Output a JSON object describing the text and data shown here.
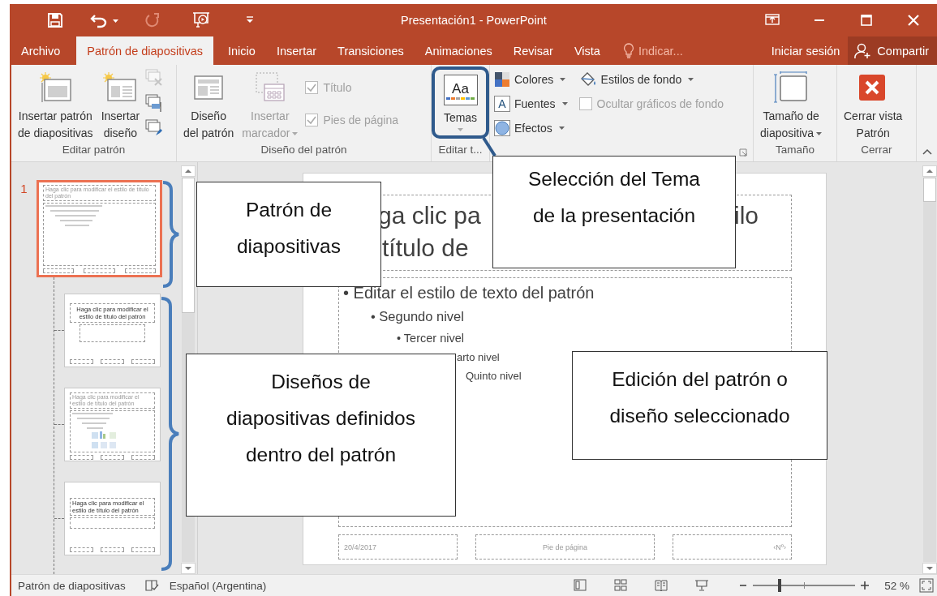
{
  "quick_access": [
    {
      "kind": "save",
      "disabled": false
    },
    {
      "kind": "undo",
      "disabled": false
    },
    {
      "kind": "redo",
      "disabled": true
    },
    {
      "kind": "present",
      "disabled": false
    },
    {
      "kind": "customize",
      "disabled": false
    }
  ],
  "window": {
    "title": "Presentación1 - PowerPoint"
  },
  "tabs": [
    {
      "label": "Archivo",
      "selected": false
    },
    {
      "label": "Patrón de diapositivas",
      "selected": true
    },
    {
      "label": "Inicio",
      "selected": false
    },
    {
      "label": "Insertar",
      "selected": false
    },
    {
      "label": "Transiciones",
      "selected": false
    },
    {
      "label": "Animaciones",
      "selected": false
    },
    {
      "label": "Revisar",
      "selected": false
    },
    {
      "label": "Vista",
      "selected": false
    }
  ],
  "tell_me": {
    "placeholder": "Indicar..."
  },
  "account": {
    "sign_in": "Iniciar sesión",
    "share": "Compartir"
  },
  "ribbon": {
    "groups": [
      {
        "label": "Editar patrón",
        "buttons": [
          {
            "label": "Insertar patrón\nde diapositivas",
            "disabled": false,
            "dropdown": false
          },
          {
            "label": "Insertar\ndiseño",
            "disabled": false,
            "dropdown": false
          }
        ],
        "small_buttons": [
          {
            "disabled": true
          },
          {
            "disabled": false
          },
          {
            "disabled": false
          }
        ]
      },
      {
        "label": "Diseño del patrón",
        "buttons": [
          {
            "label": "Diseño\ndel patrón",
            "disabled": false,
            "dropdown": false
          },
          {
            "label": "Insertar\nmarcador",
            "disabled": true,
            "dropdown": true
          }
        ],
        "checks": [
          {
            "label": "Título",
            "checked": true,
            "disabled": true
          },
          {
            "label": "Pies de página",
            "checked": true,
            "disabled": true
          }
        ]
      },
      {
        "label": "Editar t...",
        "buttons": [
          {
            "label": "Temas",
            "icon_text": "Aa",
            "disabled": false,
            "dropdown": true,
            "highlighted": true
          }
        ]
      },
      {
        "menus": [
          {
            "label": "Colores",
            "dropdown": true
          },
          {
            "label": "Fuentes",
            "icon_text": "A",
            "dropdown": true
          },
          {
            "label": "Efectos",
            "dropdown": true
          },
          {
            "label": "Estilos de fondo",
            "dropdown": true
          }
        ],
        "checks": [
          {
            "label": "Ocultar gráficos de fondo",
            "checked": false,
            "disabled": true
          }
        ]
      },
      {
        "label": "Tamaño",
        "buttons": [
          {
            "label": "Tamaño de\ndiapositiva",
            "disabled": false,
            "dropdown": true
          }
        ]
      },
      {
        "label": "Cerrar",
        "buttons": [
          {
            "label": "Cerrar vista\nPatrón",
            "disabled": false,
            "dropdown": false
          }
        ]
      }
    ]
  },
  "thumbnails": [
    {
      "number": "1",
      "kind": "master",
      "selected": true,
      "title": "Haga clic para modificar el estilo de título del patrón"
    },
    {
      "kind": "title",
      "selected": false,
      "title": "Haga clic para modificar el estilo de título del patrón"
    },
    {
      "kind": "content",
      "selected": false,
      "title": "Haga clic para modificar el estilo de título del patrón"
    },
    {
      "kind": "section",
      "selected": false,
      "title": "Haga clic para modificar el estilo de título del patrón"
    }
  ],
  "slide": {
    "title": [
      [
        "ga clic pa",
        "ilo"
      ],
      [
        "título de"
      ]
    ],
    "body": [
      {
        "text": "• Editar el estilo de texto del patrón",
        "children": [
          {
            "text": "• Segundo nivel",
            "children": [
              {
                "text": "• Tercer nivel",
                "children": [
                  {
                    "text": "arto nivel",
                    "children": [
                      {
                        "text": "Quinto nivel"
                      }
                    ]
                  }
                ]
              }
            ]
          }
        ]
      }
    ],
    "footer": [
      "20/4/2017",
      "Pie de página",
      "‹Nº›"
    ]
  },
  "callouts": [
    {
      "text": "Selección del Tema\nde la presentación"
    },
    {
      "text": "Patrón de\ndiapositivas"
    },
    {
      "text": "Diseños de\ndiapositivas definidos\ndentro del patrón"
    },
    {
      "text": "Edición del patrón o\ndiseño seleccionado"
    }
  ],
  "status_bar": {
    "mode": "Patrón de diapositivas",
    "language": "Español (Argentina)",
    "zoom": {
      "level": 0.26,
      "reading": "52 %"
    }
  }
}
